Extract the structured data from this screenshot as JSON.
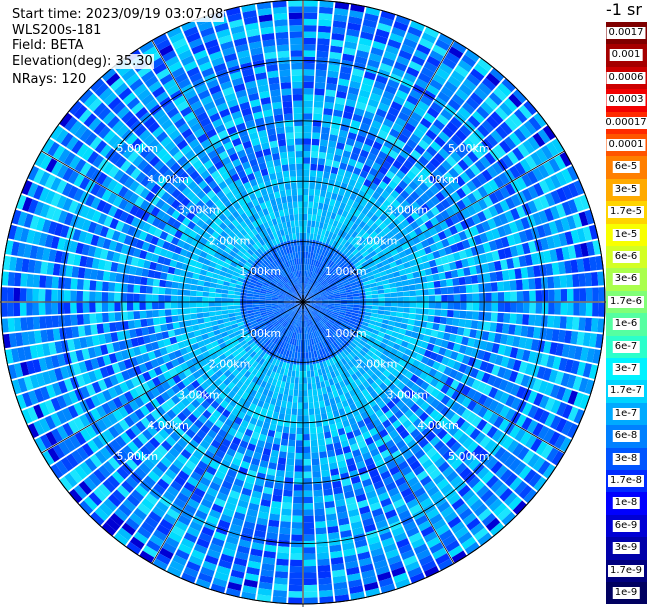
{
  "info": {
    "start_time": "Start time: 2023/09/19 03:07:08",
    "instrument": "WLS200s-181",
    "field": "Field: BETA",
    "elevation": "Elevation(deg): 35.30",
    "nrays": "NRays: 120"
  },
  "colorbar": {
    "title": "-1 sr",
    "labels": [
      "0.0017",
      "0.001",
      "0.0006",
      "0.0003",
      "0.00017",
      "0.0001",
      "6e-5",
      "3e-5",
      "1.7e-5",
      "1e-5",
      "6e-6",
      "3e-6",
      "1.7e-6",
      "1e-6",
      "6e-7",
      "3e-7",
      "1.7e-7",
      "1e-7",
      "6e-8",
      "3e-8",
      "1.7e-8",
      "1e-8",
      "6e-9",
      "3e-9",
      "1.7e-9",
      "1e-9"
    ],
    "colors": [
      "#7f0000",
      "#a50000",
      "#cc0000",
      "#f20000",
      "#ff2a00",
      "#ff5500",
      "#ff7f00",
      "#ffaa00",
      "#ffd400",
      "#f8ff00",
      "#d3ff24",
      "#aaff4d",
      "#80ff77",
      "#55ffa1",
      "#2bffcb",
      "#00f2ff",
      "#00d4ff",
      "#00aaff",
      "#0080ff",
      "#0055ff",
      "#002bff",
      "#0000ff",
      "#0000d4",
      "#0000aa",
      "#00007f",
      "#000060"
    ]
  },
  "chart_data": {
    "type": "heatmap",
    "projection": "polar (PPI scan)",
    "field": "BETA",
    "n_rays": 120,
    "max_range_km": 5.0,
    "range_ring_labels": [
      "1.00km",
      "2.00km",
      "3.00km",
      "4.00km",
      "5.00km"
    ],
    "color_scale": "log",
    "value_range": [
      1e-09,
      0.0017
    ],
    "dominant_values": "mostly 1e-8 to 1.7e-7 (blue to cyan)"
  }
}
